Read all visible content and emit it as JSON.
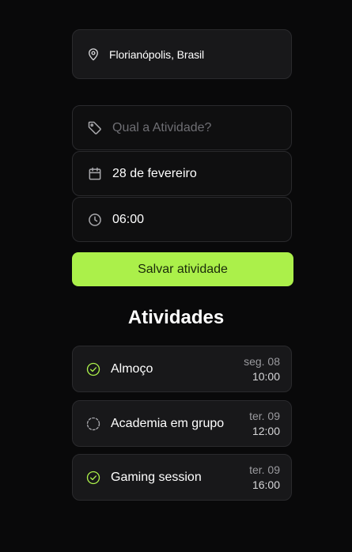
{
  "location": {
    "label": "Florianópolis, Brasil",
    "icon": "map-pin-icon"
  },
  "form": {
    "activity_placeholder": "Qual a Atividade?",
    "activity_value": "",
    "date_value": "28 de fevereiro",
    "time_value": "06:00",
    "save_label": "Salvar atividade"
  },
  "activities_title": "Atividades",
  "activities": [
    {
      "name": "Almoço",
      "day": "seg. 08",
      "time": "10:00",
      "done": true
    },
    {
      "name": "Academia em grupo",
      "day": "ter. 09",
      "time": "12:00",
      "done": false
    },
    {
      "name": "Gaming session",
      "day": "ter. 09",
      "time": "16:00",
      "done": true
    }
  ],
  "colors": {
    "accent": "#abf04a",
    "background": "#09090a",
    "card": "#18181a"
  }
}
